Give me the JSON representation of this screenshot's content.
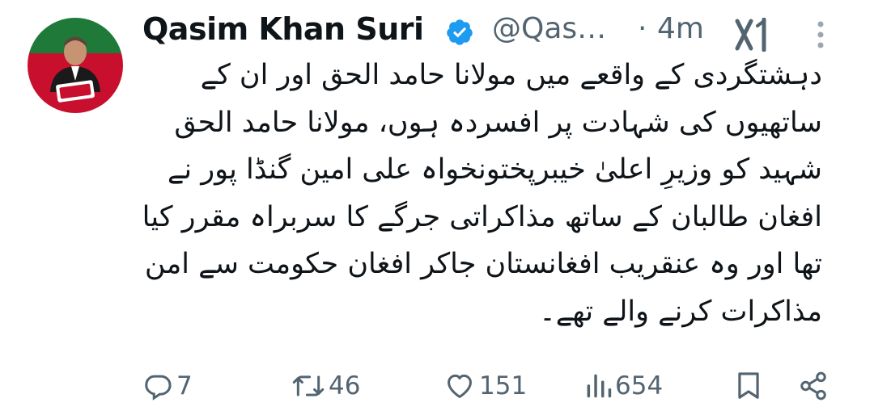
{
  "author": {
    "name": "Qasim Khan Suri",
    "handle": "@Qas…",
    "separator": "·",
    "time": "4m"
  },
  "tweet": {
    "text": "دہشتگردی کے واقعے میں مولانا حامد الحق اور ان کے ساتھیوں کی شہادت پر افسردہ ہوں، مولانا حامد الحق شہید کو وزیرِ اعلیٰ خیبرپختونخواہ علی امین گنڈا پور نے افغان طالبان کے ساتھ مذاکراتی جرگے کا سربراہ مقرر کیا تھا اور وہ عنقریب افغانستان جاکر افغان حکومت سے امن مذاکرات کرنے والے تھے۔"
  },
  "actions": {
    "replies": "7",
    "reposts": "46",
    "likes": "151",
    "views": "654"
  },
  "icons": {
    "verified": "verified-badge-icon",
    "grok": "grok-icon",
    "more": "more-vertical-icon",
    "reply": "reply-icon",
    "repost": "repost-icon",
    "like": "heart-icon",
    "views": "views-icon",
    "bookmark": "bookmark-icon",
    "share": "share-icon"
  },
  "colors": {
    "text": "#0f1419",
    "secondary": "#536471",
    "verified": "#1d9bf0",
    "avatar_green": "#1f7a3a",
    "avatar_red": "#c8102e"
  }
}
